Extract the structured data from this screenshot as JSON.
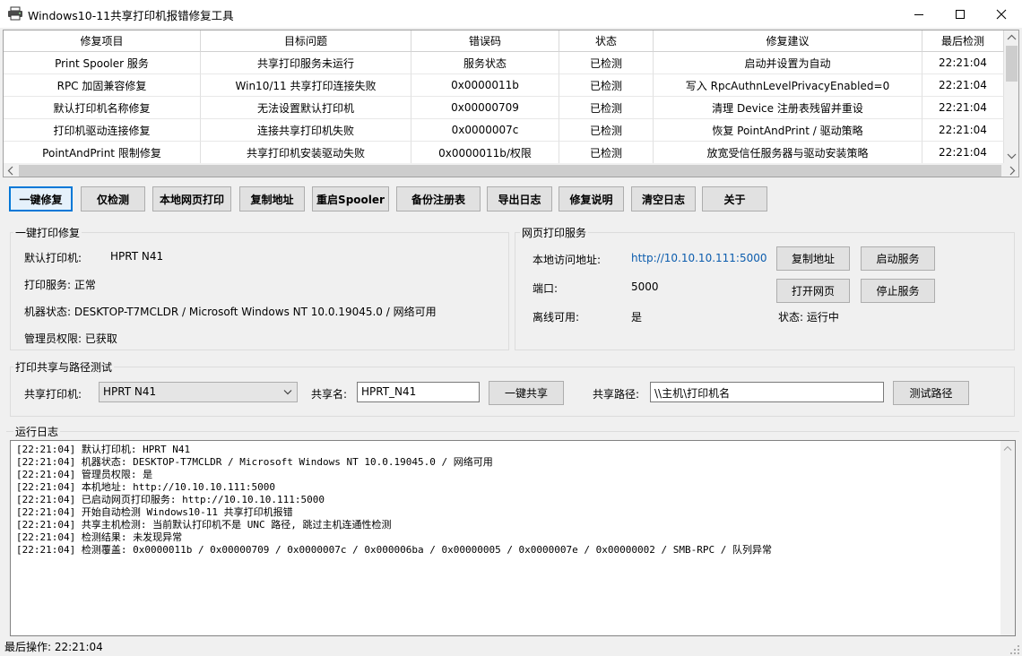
{
  "window": {
    "title": "Windows10-11共享打印机报错修复工具",
    "icons": {
      "app": "printer-icon",
      "minimize": "minimize-icon",
      "maximize": "maximize-icon",
      "close": "close-icon"
    }
  },
  "grid": {
    "columns": [
      "修复项目",
      "目标问题",
      "错误码",
      "状态",
      "修复建议",
      "最后检测"
    ],
    "rows": [
      [
        "Print Spooler 服务",
        "共享打印服务未运行",
        "服务状态",
        "已检测",
        "启动并设置为自动",
        "22:21:04"
      ],
      [
        "RPC 加固兼容修复",
        "Win10/11 共享打印连接失败",
        "0x0000011b",
        "已检测",
        "写入 RpcAuthnLevelPrivacyEnabled=0",
        "22:21:04"
      ],
      [
        "默认打印机名称修复",
        "无法设置默认打印机",
        "0x00000709",
        "已检测",
        "清理 Device 注册表残留并重设",
        "22:21:04"
      ],
      [
        "打印机驱动连接修复",
        "连接共享打印机失败",
        "0x0000007c",
        "已检测",
        "恢复 PointAndPrint / 驱动策略",
        "22:21:04"
      ],
      [
        "PointAndPrint 限制修复",
        "共享打印机安装驱动失败",
        "0x0000011b/权限",
        "已检测",
        "放宽受信任服务器与驱动安装策略",
        "22:21:04"
      ]
    ]
  },
  "toolbar": {
    "buttons": [
      "一键修复",
      "仅检测",
      "本地网页打印",
      "复制地址",
      "重启Spooler",
      "备份注册表",
      "导出日志",
      "修复说明",
      "清空日志",
      "关于"
    ]
  },
  "oneclick": {
    "title": "一键打印修复",
    "default_printer_label": "默认打印机:",
    "default_printer_value": "HPRT N41",
    "print_service": "打印服务: 正常",
    "machine_status": "机器状态: DESKTOP-T7MCLDR / Microsoft Windows NT 10.0.19045.0 / 网络可用",
    "admin": "管理员权限: 已获取"
  },
  "web": {
    "title": "网页打印服务",
    "url_label": "本地访问地址:",
    "url_value": "http://10.10.10.111:5000",
    "port_label": "端口:",
    "port_value": "5000",
    "offline_label": "离线可用:",
    "offline_value": "是",
    "status": "状态: 运行中",
    "btn_copy": "复制地址",
    "btn_start": "启动服务",
    "btn_open": "打开网页",
    "btn_stop": "停止服务",
    "link_color": "#0b5cad"
  },
  "share": {
    "title": "打印共享与路径测试",
    "printer_label": "共享打印机:",
    "printer_value": "HPRT N41",
    "name_label": "共享名:",
    "name_value": "HPRT_N41",
    "btn_share": "一键共享",
    "path_label": "共享路径:",
    "path_value": "\\\\主机\\打印机名",
    "btn_test": "测试路径"
  },
  "log": {
    "title": "运行日志",
    "lines": [
      "[22:21:04] 默认打印机: HPRT N41",
      "[22:21:04] 机器状态: DESKTOP-T7MCLDR / Microsoft Windows NT 10.0.19045.0 / 网络可用",
      "[22:21:04] 管理员权限: 是",
      "[22:21:04] 本机地址: http://10.10.10.111:5000",
      "[22:21:04] 已启动网页打印服务: http://10.10.10.111:5000",
      "[22:21:04] 开始自动检测 Windows10-11 共享打印机报错",
      "[22:21:04] 共享主机检测: 当前默认打印机不是 UNC 路径, 跳过主机连通性检测",
      "[22:21:04] 检测结果: 未发现异常",
      "[22:21:04] 检测覆盖: 0x0000011b / 0x00000709 / 0x0000007c / 0x000006ba / 0x00000005 / 0x0000007e / 0x00000002 / SMB-RPC / 队列异常"
    ]
  },
  "status_bar": {
    "text": "最后操作: 22:21:04"
  },
  "colors": {
    "accent": "#0078d7",
    "window_bg": "#f0f0f0"
  }
}
